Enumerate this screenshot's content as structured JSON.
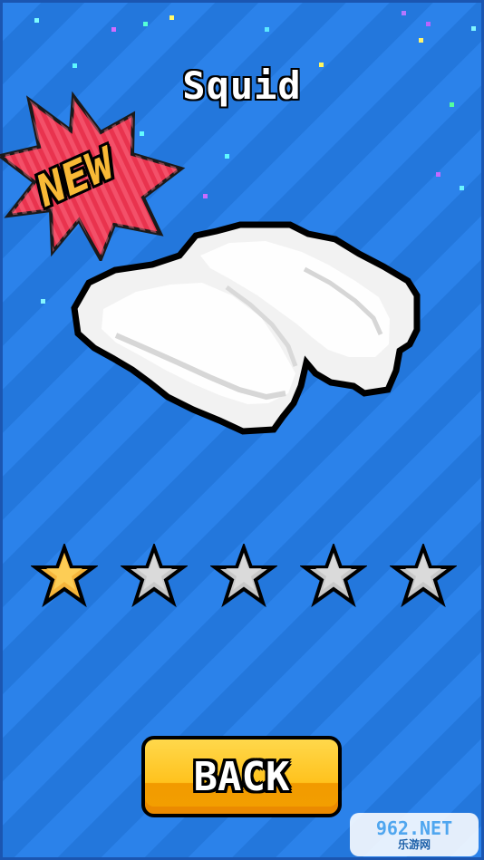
{
  "screen": {
    "title": "Squid",
    "badge_label": "NEW",
    "button_label": "BACK",
    "rating_value": 1,
    "rating_max": 5,
    "watermark_line1": "962.NET",
    "watermark_line2": "乐游网"
  },
  "colors": {
    "background_primary": "#2b82ea",
    "background_secondary": "#2377dc",
    "badge_red": "#e9334e",
    "badge_yellow": "#f8b936",
    "button_yellow": "#ffc21d",
    "star_filled": "#f5b53a",
    "star_empty": "#c8c8c8"
  },
  "icons": {
    "badge": "starburst-badge-icon",
    "item": "white-cloth-item-icon",
    "rating_filled": "star-filled-icon",
    "rating_empty": "star-empty-icon"
  }
}
